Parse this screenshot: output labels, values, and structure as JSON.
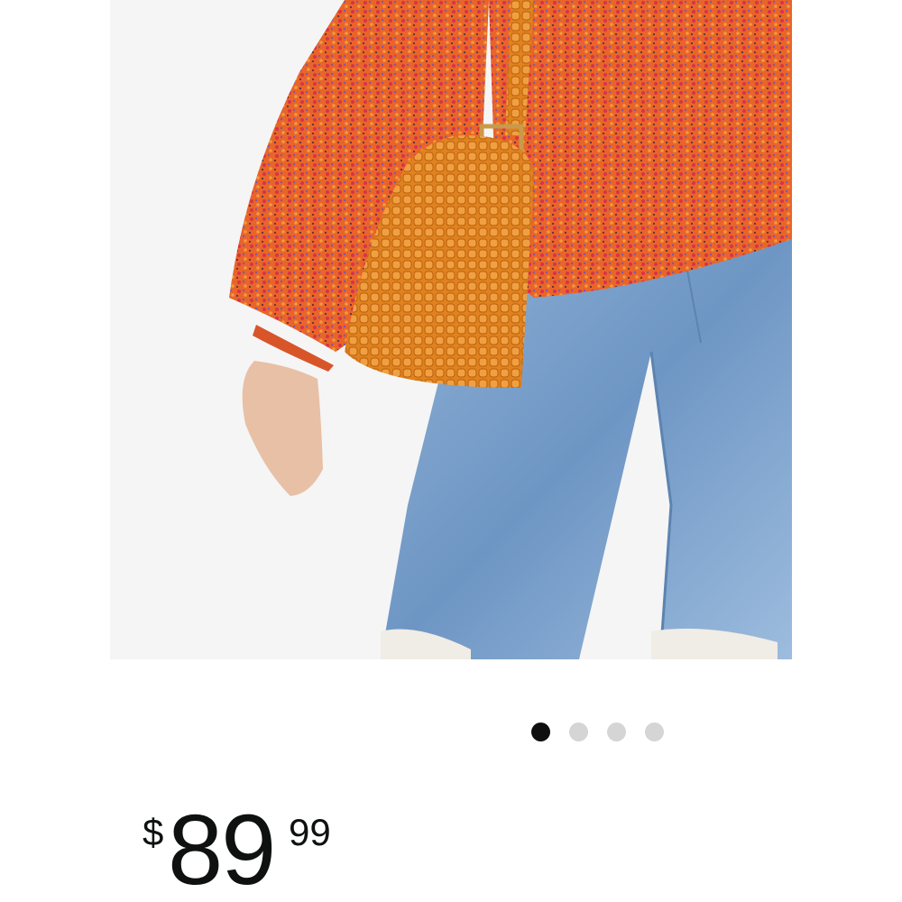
{
  "product": {
    "image": {
      "subject": "model-wearing-orange-knit-sweater-jeans-croc-bag",
      "background_color": "#f5f5f5"
    },
    "carousel": {
      "total": 4,
      "active_index": 0,
      "active_color": "#0f0f0f",
      "inactive_color": "#d5d5d5"
    },
    "price": {
      "symbol": "$",
      "whole": "89",
      "fraction": "99"
    }
  }
}
